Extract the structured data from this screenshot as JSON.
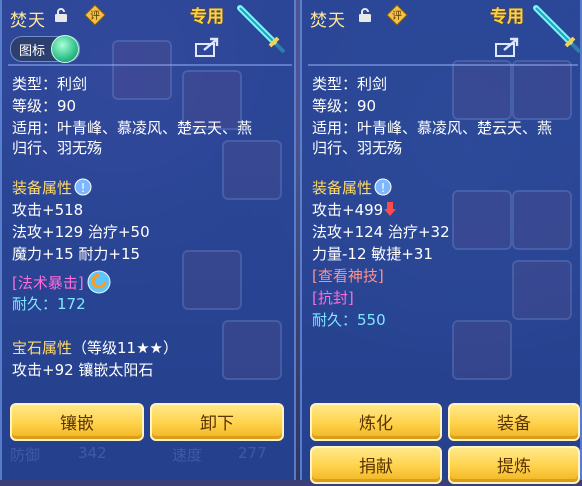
{
  "left_panel": {
    "title": "焚天",
    "exclusive_label": "专用",
    "toggle_label": "图标",
    "item_type": "类型：利剑",
    "item_level": "等级：90",
    "applicable_1": "适用：叶青峰、慕凌风、楚云天、燕",
    "applicable_2": "归行、羽无殇",
    "attr_header": "装备属性",
    "attr_1": "攻击+518",
    "attr_2": "法攻+129 治疗+50",
    "attr_3": "魔力+15 耐力+15",
    "skill": "[法术暴击]",
    "durability": "耐久：172",
    "gem_header": "宝石属性",
    "gem_level": "（等级11★★）",
    "gem_effect": "攻击+92 镶嵌太阳石",
    "btn_inlay": "镶嵌",
    "btn_unequip": "卸下"
  },
  "right_panel": {
    "title": "焚天",
    "exclusive_label": "专用",
    "item_type": "类型：利剑",
    "item_level": "等级：90",
    "applicable_1": "适用：叶青峰、慕凌风、楚云天、燕",
    "applicable_2": "归行、羽无殇",
    "attr_header": "装备属性",
    "attr_1": "攻击+499",
    "attr_2": "法攻+124 治疗+32",
    "attr_3": "力量-12 敏捷+31",
    "view_skill": "[查看神技]",
    "seal": "[抗封]",
    "durability": "耐久：550",
    "btn_refine": "炼化",
    "btn_equip": "装备",
    "btn_donate": "捐献",
    "btn_extract": "提炼"
  },
  "background": {
    "stat_1": "防御",
    "stat_1_value": "342",
    "stat_2": "速度",
    "stat_2_value": "277"
  },
  "colors": {
    "attr_header": "#ffd96a",
    "skill": "#ff6bd9",
    "durability": "#7ee8ff",
    "button": "#ffd24a"
  }
}
